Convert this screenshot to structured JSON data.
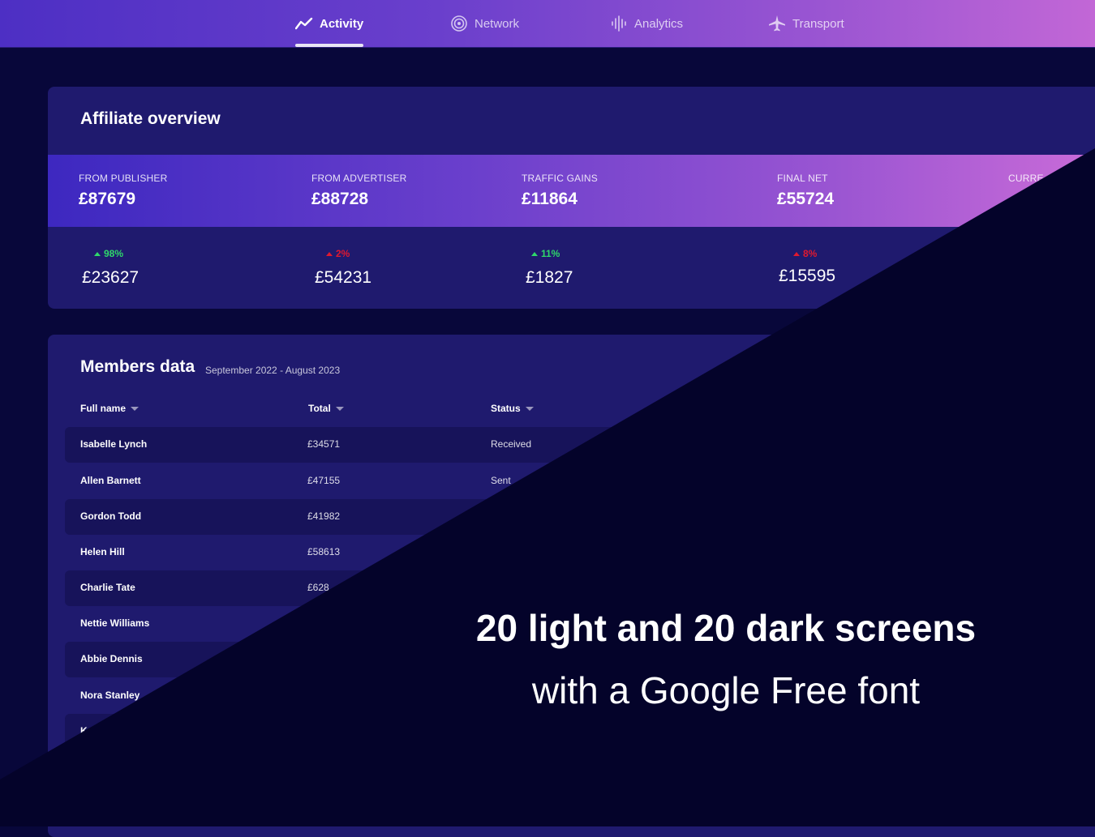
{
  "nav": {
    "tabs": [
      {
        "label": "Activity",
        "icon": "trend-line-icon",
        "active": true
      },
      {
        "label": "Network",
        "icon": "broadcast-icon",
        "active": false
      },
      {
        "label": "Analytics",
        "icon": "sound-wave-icon",
        "active": false
      },
      {
        "label": "Transport",
        "icon": "airplane-icon",
        "active": false
      }
    ]
  },
  "overview": {
    "title": "Affiliate overview",
    "stats": [
      {
        "label": "FROM PUBLISHER",
        "value": "£87679",
        "delta": "98%",
        "direction": "up",
        "sub_value": "£23627"
      },
      {
        "label": "FROM ADVERTISER",
        "value": "£88728",
        "delta": "2%",
        "direction": "down",
        "sub_value": "£54231"
      },
      {
        "label": "TRAFFIC GAINS",
        "value": "£11864",
        "delta": "11%",
        "direction": "up",
        "sub_value": "£1827"
      },
      {
        "label": "FINAL NET",
        "value": "£55724",
        "delta": "8%",
        "direction": "down",
        "sub_value": "£15595"
      },
      {
        "label": "CURRE",
        "value": "",
        "delta": "",
        "direction": "",
        "sub_value": ""
      }
    ]
  },
  "members": {
    "title": "Members data",
    "range": "September 2022 - August 2023",
    "columns": {
      "name": "Full name",
      "total": "Total",
      "status": "Status"
    },
    "rows": [
      {
        "name": "Isabelle Lynch",
        "total": "£34571",
        "status": "Received"
      },
      {
        "name": "Allen Barnett",
        "total": "£47155",
        "status": "Sent"
      },
      {
        "name": "Gordon Todd",
        "total": "£41982",
        "status": ""
      },
      {
        "name": "Helen Hill",
        "total": "£58613",
        "status": ""
      },
      {
        "name": "Charlie Tate",
        "total": "£628",
        "status": ""
      },
      {
        "name": "Nettie Williams",
        "total": "",
        "status": ""
      },
      {
        "name": "Abbie Dennis",
        "total": "",
        "status": ""
      },
      {
        "name": "Nora Stanley",
        "total": "",
        "status": ""
      },
      {
        "name": "K",
        "total": "",
        "status": ""
      }
    ]
  },
  "promo": {
    "line1": "20 light and 20 dark screens",
    "line2": "with a Google Free font"
  },
  "colors": {
    "background": "#08073a",
    "card": "#1f1a6e",
    "gradient_start": "#4d2fc4",
    "gradient_end": "#c267d6",
    "up": "#2fd86a",
    "down": "#e0192f",
    "overlay": "#04032a"
  }
}
